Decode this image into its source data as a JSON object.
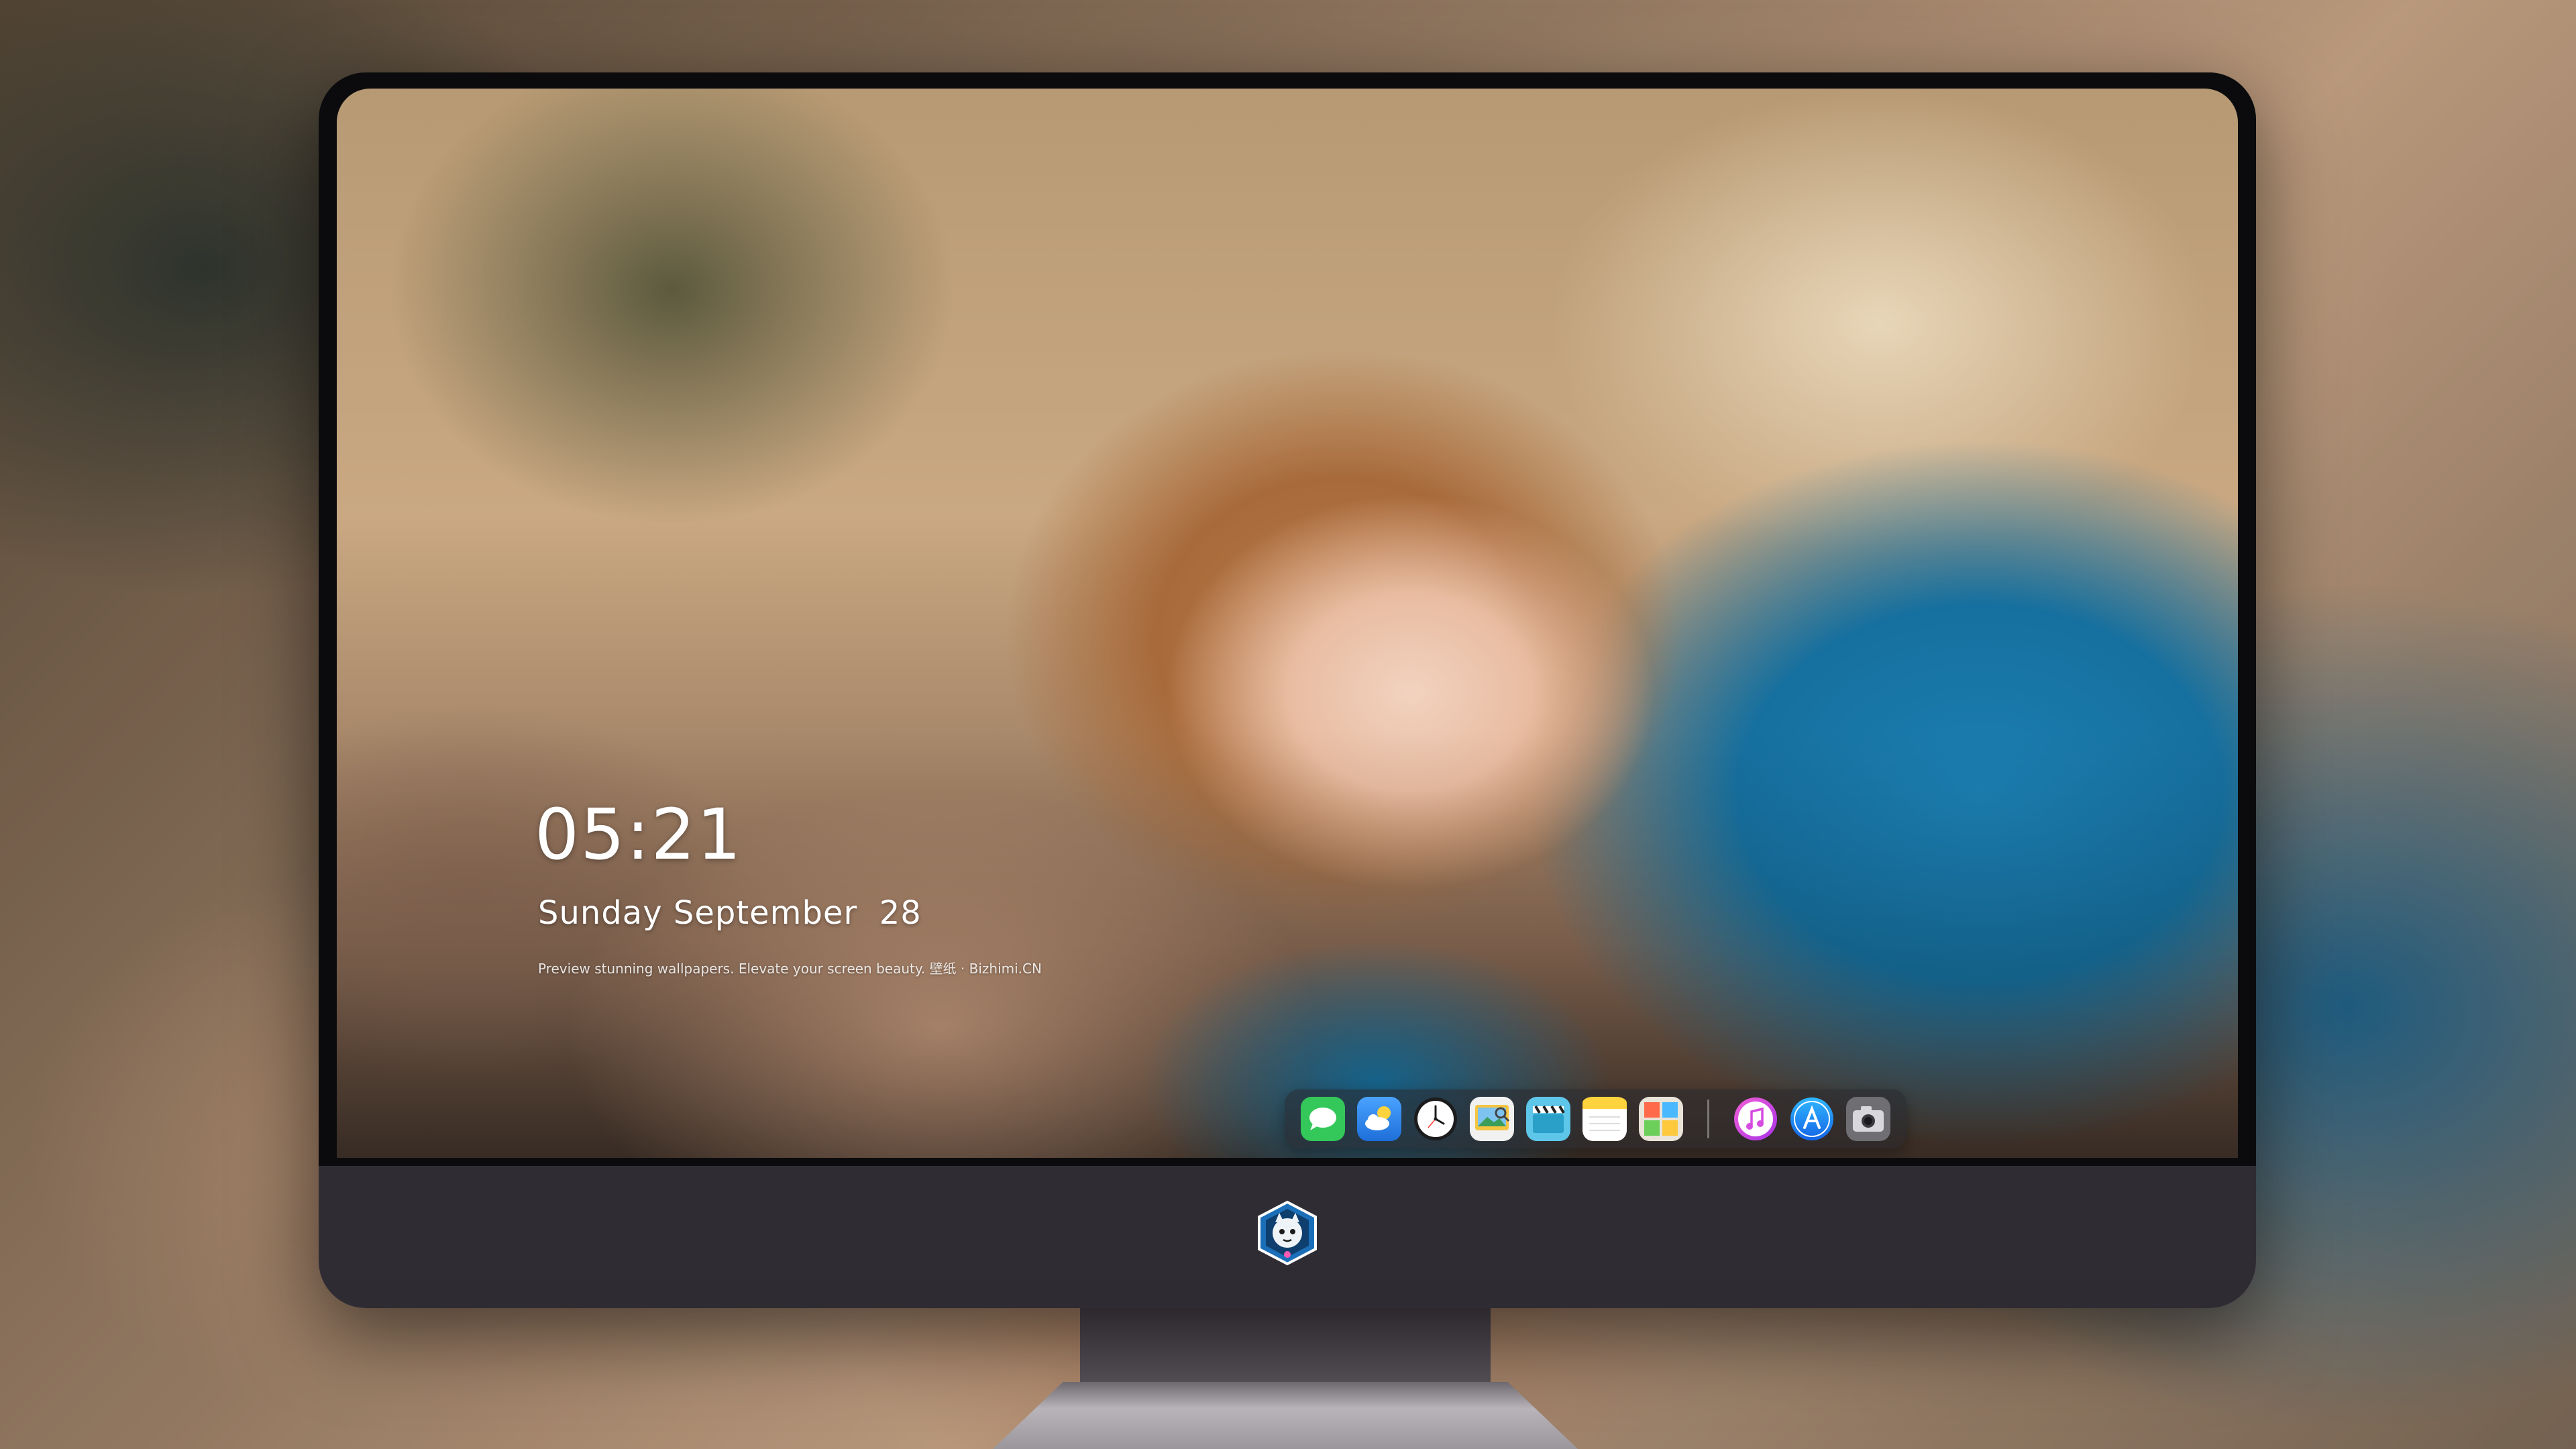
{
  "lockscreen": {
    "time": "05:21",
    "date": "Sunday September  28",
    "tagline": "Preview stunning wallpapers. Elevate your screen beauty. 壁纸 · Bizhimi.CN"
  },
  "dock": {
    "apps": [
      {
        "icon": "messages-icon",
        "color": "#34c759"
      },
      {
        "icon": "weather-icon",
        "color": "#3b8ff0"
      },
      {
        "icon": "clock-icon",
        "color": "#1c1c1e"
      },
      {
        "icon": "preview-icon",
        "color": "#f5c542"
      },
      {
        "icon": "claquette-icon",
        "color": "#5ec6e8"
      },
      {
        "icon": "notes-icon",
        "color": "#ffd33d"
      },
      {
        "icon": "photo-booth-icon",
        "color": "#e8e4d8"
      }
    ],
    "pinned": [
      {
        "icon": "itunes-icon",
        "color": "#d64be0"
      },
      {
        "icon": "app-store-icon",
        "color": "#1e7cf2"
      },
      {
        "icon": "camera-icon",
        "color": "#6e6e73"
      }
    ]
  },
  "brand": {
    "logo": "mascot-logo-icon"
  }
}
